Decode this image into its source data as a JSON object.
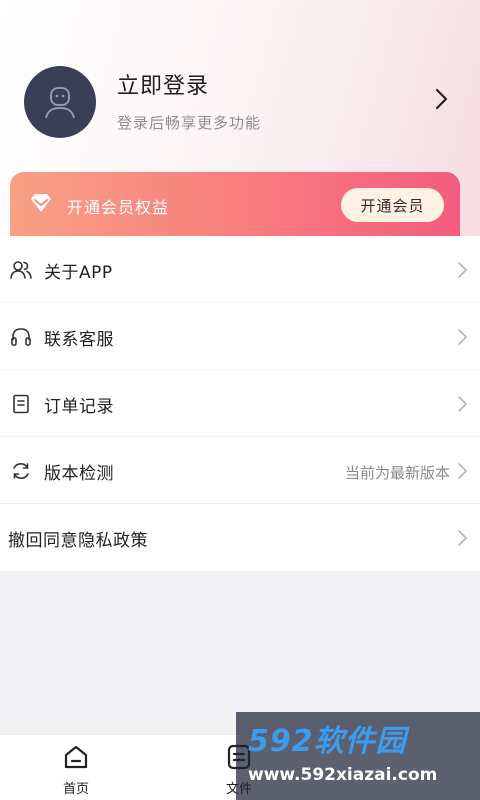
{
  "profile": {
    "title": "立即登录",
    "subtitle": "登录后畅享更多功能"
  },
  "vip": {
    "label": "开通会员权益",
    "button": "开通会员"
  },
  "menu": {
    "items": [
      {
        "label": "关于APP",
        "icon": "users-icon"
      },
      {
        "label": "联系客服",
        "icon": "headset-icon"
      },
      {
        "label": "订单记录",
        "icon": "order-icon"
      },
      {
        "label": "版本检测",
        "icon": "refresh-icon",
        "value": "当前为最新版本"
      },
      {
        "label": "撤回同意隐私政策"
      }
    ]
  },
  "tabbar": {
    "items": [
      {
        "label": "首页",
        "icon": "home-icon"
      },
      {
        "label": "文件",
        "icon": "file-icon"
      }
    ]
  },
  "watermark": {
    "top": "592软件园",
    "bottom": "www.592xiazai.com"
  },
  "colors": {
    "avatar_bg": "#3a3f56",
    "vip_gradient_start": "#f7a083",
    "vip_gradient_end": "#f45c7f",
    "vip_button_bg": "#fdf2e3",
    "page_bg": "#f2f2f5",
    "watermark_blue": "#3b9cf0"
  }
}
